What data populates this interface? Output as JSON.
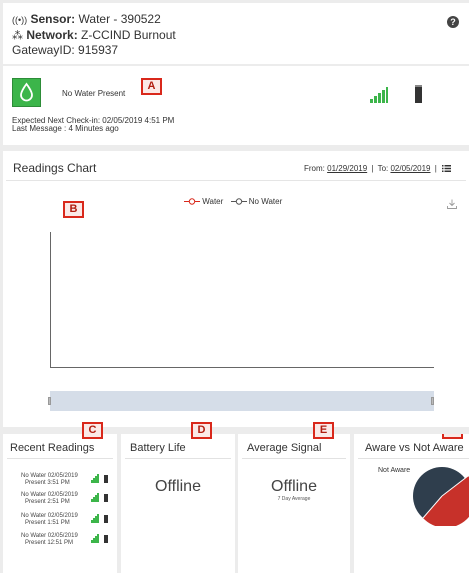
{
  "header": {
    "sensor_label": "Sensor:",
    "sensor_value": "Water - 390522",
    "network_label": "Network:",
    "network_value": "Z-CCIND Burnout",
    "gateway_label": "GatewayID:",
    "gateway_value": "915937",
    "help_icon": "?"
  },
  "status": {
    "text": "No Water Present",
    "next_checkin": "Expected Next Check-in: 02/05/2019 4:51 PM",
    "last_message": "Last Message : 4 Minutes ago",
    "accent_color": "#3cb54a",
    "signal_level": 1.0,
    "icons": [
      "water-drop-icon",
      "signal-bars-icon",
      "battery-icon"
    ]
  },
  "annotations": [
    "A",
    "B",
    "C",
    "D",
    "E",
    "F"
  ],
  "chart": {
    "title": "Readings Chart",
    "from_label": "From:",
    "from_date": "01/29/2019",
    "to_label": "To:",
    "to_date": "02/05/2019",
    "legend": [
      "Water",
      "No Water"
    ],
    "legend_color": "#d9281b"
  },
  "recent_readings": {
    "title": "Recent Readings",
    "items": [
      {
        "line1": "No Water 02/05/2019",
        "line2": "Present  3:51 PM"
      },
      {
        "line1": "No Water 02/05/2019",
        "line2": "Present  2:51 PM"
      },
      {
        "line1": "No Water 02/05/2019",
        "line2": "Present  1:51 PM"
      },
      {
        "line1": "No Water 02/05/2019",
        "line2": "Present  12:51 PM"
      }
    ]
  },
  "battery_life": {
    "title": "Battery Life",
    "value": "Offline"
  },
  "average_signal": {
    "title": "Average Signal",
    "value": "Offline",
    "note": "7 Day Average"
  },
  "aware": {
    "title": "Aware vs Not Aware",
    "label": "Not Aware",
    "colors": [
      "#2f3e4d",
      "#c7312a"
    ]
  }
}
